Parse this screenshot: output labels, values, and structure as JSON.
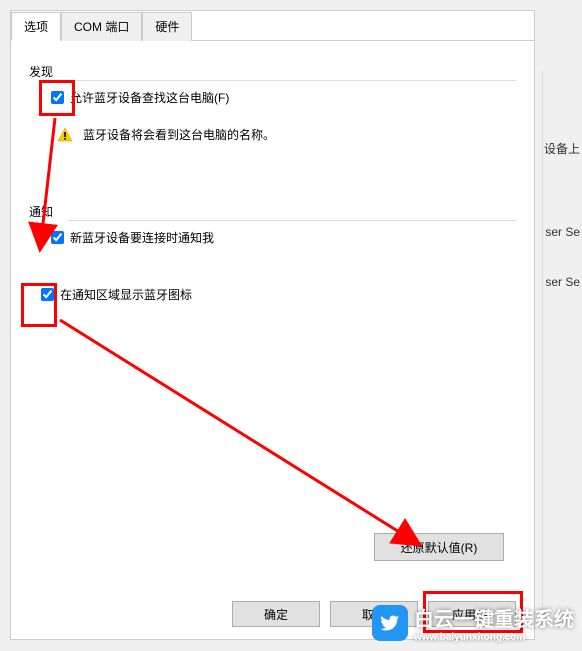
{
  "tabs": {
    "options": "选项",
    "com_port": "COM 端口",
    "hardware": "硬件"
  },
  "groups": {
    "discovery": {
      "title": "发现",
      "allow_find": "允许蓝牙设备查找这台电脑(F)",
      "warning": "蓝牙设备将会看到这台电脑的名称。"
    },
    "notification": {
      "title": "通知",
      "notify_connect": "新蓝牙设备要连接时通知我",
      "show_tray": "在通知区域显示蓝牙图标"
    }
  },
  "buttons": {
    "restore": "还原默认值(R)",
    "ok": "确定",
    "cancel": "取消",
    "apply": "应用(A)"
  },
  "background": {
    "text1": "设备上",
    "text2": "ser Se",
    "text3": "ser Se"
  },
  "watermark": {
    "title": "白云一键重装系统",
    "url": "www.baiyunxitong.com"
  }
}
